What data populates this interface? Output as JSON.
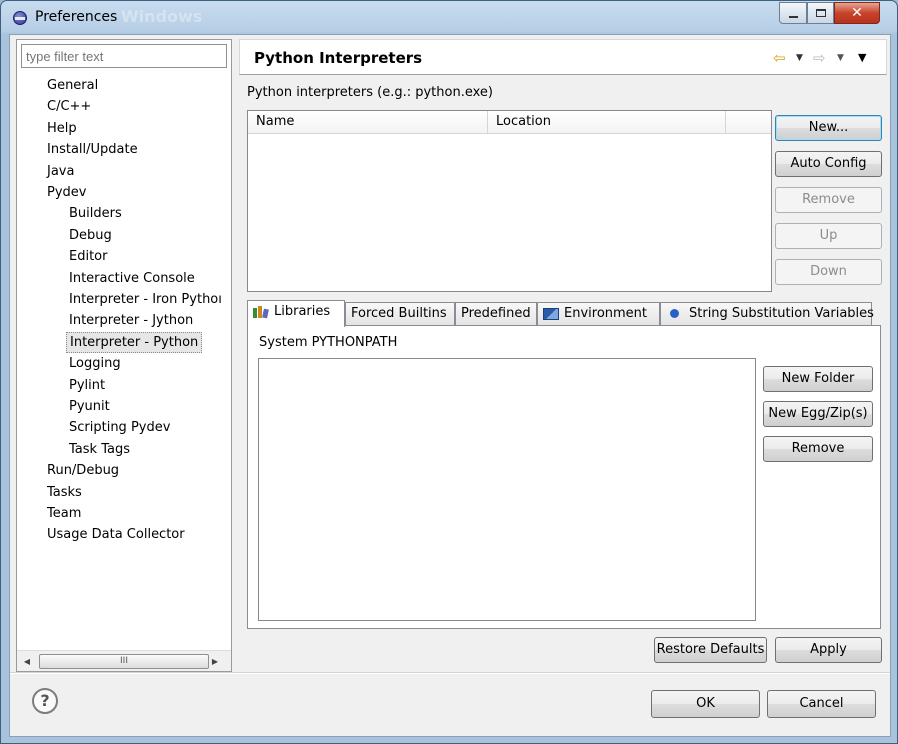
{
  "window": {
    "title": "Preferences",
    "watermark": "Windows"
  },
  "filter": {
    "placeholder": "type filter text"
  },
  "tree": [
    {
      "label": "General",
      "level": 0
    },
    {
      "label": "C/C++",
      "level": 0
    },
    {
      "label": "Help",
      "level": 0
    },
    {
      "label": "Install/Update",
      "level": 0
    },
    {
      "label": "Java",
      "level": 0
    },
    {
      "label": "Pydev",
      "level": 0
    },
    {
      "label": "Builders",
      "level": 1
    },
    {
      "label": "Debug",
      "level": 1
    },
    {
      "label": "Editor",
      "level": 1
    },
    {
      "label": "Interactive Console",
      "level": 1
    },
    {
      "label": "Interpreter - Iron Pythoı",
      "level": 1
    },
    {
      "label": "Interpreter - Jython",
      "level": 1
    },
    {
      "label": "Interpreter - Python",
      "level": 1,
      "selected": true
    },
    {
      "label": "Logging",
      "level": 1
    },
    {
      "label": "Pylint",
      "level": 1
    },
    {
      "label": "Pyunit",
      "level": 1
    },
    {
      "label": "Scripting Pydev",
      "level": 1
    },
    {
      "label": "Task Tags",
      "level": 1
    },
    {
      "label": "Run/Debug",
      "level": 0
    },
    {
      "label": "Tasks",
      "level": 0
    },
    {
      "label": "Team",
      "level": 0
    },
    {
      "label": "Usage Data Collector",
      "level": 0
    }
  ],
  "page": {
    "title": "Python Interpreters",
    "interpreters_label": "Python interpreters (e.g.: python.exe)",
    "columns": [
      "Name",
      "Location"
    ]
  },
  "interpreter_buttons": {
    "new": "New...",
    "auto_config": "Auto Config",
    "remove": "Remove",
    "up": "Up",
    "down": "Down"
  },
  "tabs": [
    {
      "label": "Libraries",
      "icon": "libraries-icon",
      "active": true
    },
    {
      "label": "Forced Builtins"
    },
    {
      "label": "Predefined"
    },
    {
      "label": "Environment",
      "icon": "environment-icon"
    },
    {
      "label": "String Substitution Variables",
      "icon": "variables-dot-icon"
    }
  ],
  "libraries": {
    "label": "System PYTHONPATH",
    "buttons": {
      "new_folder": "New Folder",
      "new_egg": "New Egg/Zip(s)",
      "remove": "Remove"
    }
  },
  "footer": {
    "restore_defaults": "Restore Defaults",
    "apply": "Apply",
    "ok": "OK",
    "cancel": "Cancel"
  },
  "scrollbar": {
    "thumb_grip": "III"
  },
  "colors": {
    "title_bar": "#b6cee6",
    "close_button": "#c7442b",
    "nav_back": "#d8a21a",
    "tab_dot": "#2862c8"
  }
}
